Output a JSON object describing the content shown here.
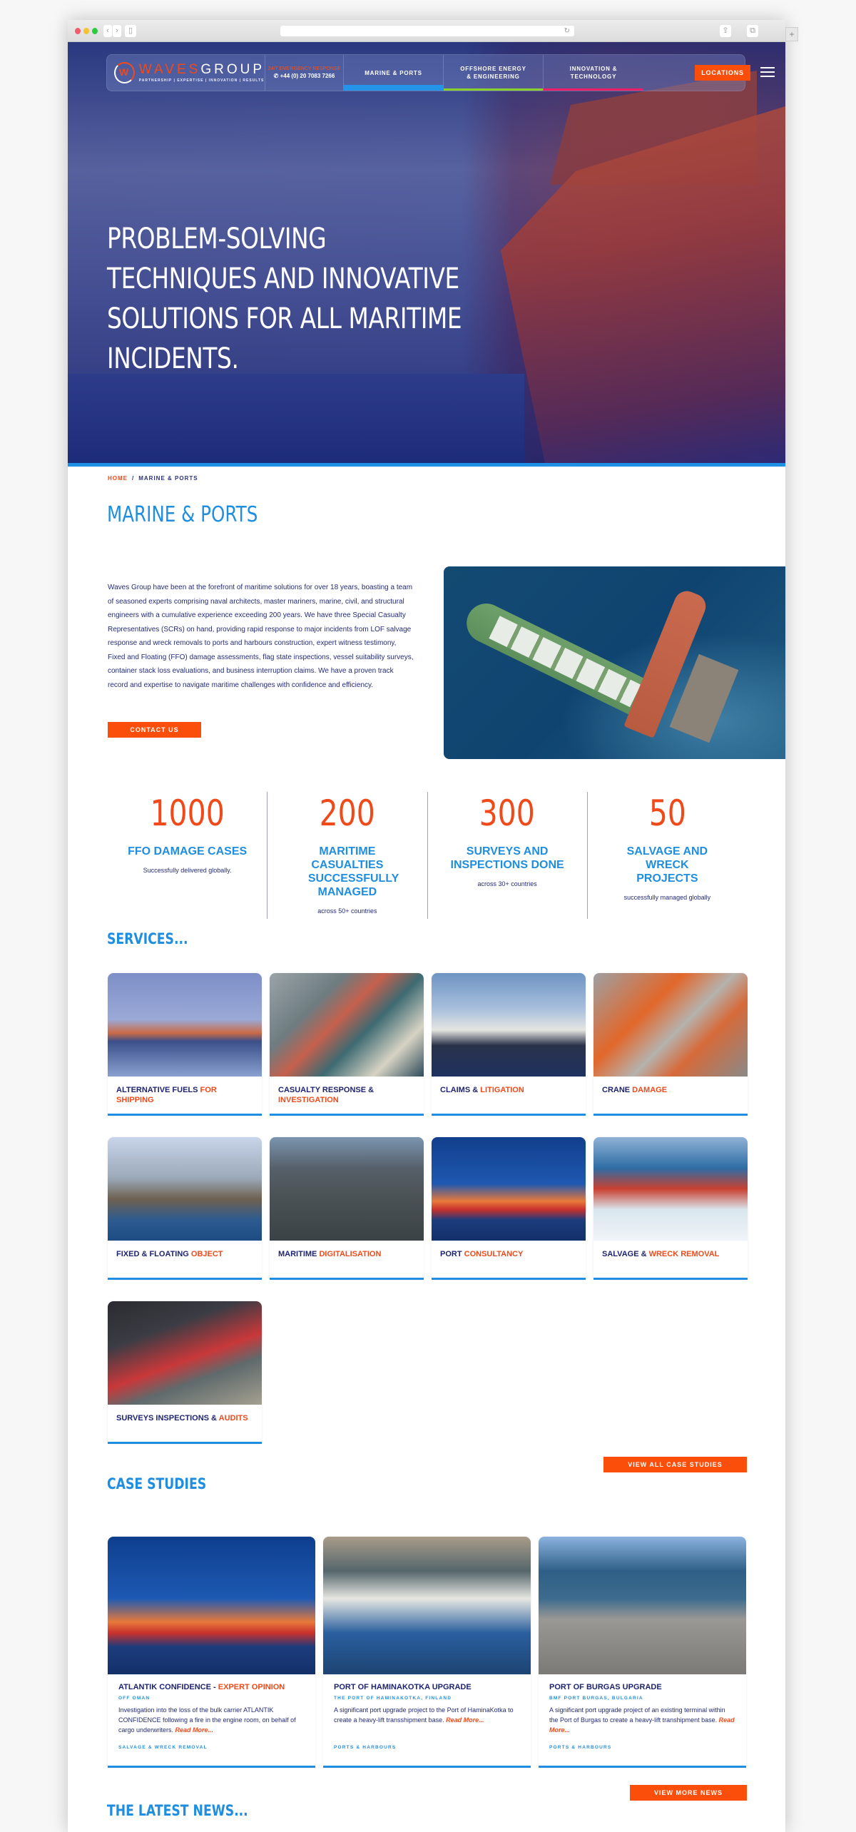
{
  "browser": {
    "back_icon": "‹",
    "forward_icon": "›",
    "sidebar_icon": "▯",
    "reload_icon": "↻",
    "share_icon": "⇪",
    "tabs_icon": "⧉",
    "new_tab_icon": "+"
  },
  "header": {
    "logo": {
      "waves": "WAVES",
      "group": "GROUP",
      "tagline": "PARTNERSHIP | EXPERTISE | INNOVATION | RESULTS"
    },
    "emergency": {
      "label": "24/7 EMERGENCY RESPONSE",
      "phone": "✆ +44 (0) 20 7083 7266"
    },
    "nav": [
      {
        "label": "MARINE & PORTS"
      },
      {
        "label": "OFFSHORE ENERGY & ENGINEERING"
      },
      {
        "label": "INNOVATION & TECHNOLOGY"
      }
    ],
    "locations_label": "LOCATIONS",
    "nav_colors": {
      "marine": "#2394e8",
      "offshore": "#8bd12e",
      "innovation": "#ec1e6a"
    }
  },
  "hero": {
    "headline": "PROBLEM-SOLVING\nTECHNIQUES AND INNOVATIVE\nSOLUTIONS FOR ALL MARITIME\nINCIDENTS."
  },
  "breadcrumb": {
    "home": "HOME",
    "separator": "/",
    "current": "MARINE & PORTS"
  },
  "intro": {
    "title": "MARINE & PORTS",
    "body": "Waves Group have been at the forefront of maritime solutions for over 18 years, boasting a team of seasoned experts comprising naval architects, master mariners, marine, civil, and structural engineers with a cumulative experience exceeding 200 years. We have three Special Casualty Representatives (SCRs) on hand,  providing rapid response to major incidents from LOF salvage response and wreck removals to ports and harbours construction, expert witness testimony, Fixed and Floating (FFO) damage assessments, flag state inspections, vessel suitability surveys, container stack loss evaluations, and business interruption claims. We have a proven track record and expertise to navigate maritime challenges with confidence and efficiency.",
    "cta": "CONTACT US"
  },
  "stats": [
    {
      "value": "1000",
      "label": "FFO DAMAGE CASES",
      "sub": "Successfully delivered globally."
    },
    {
      "value": "200",
      "label": "MARITIME CASUALTIES SUCCESSFULLY MANAGED",
      "sub": "across 50+ countries"
    },
    {
      "value": "300",
      "label": "SURVEYS AND INSPECTIONS DONE",
      "sub": "across 30+ countries"
    },
    {
      "value": "50",
      "label": "SALVAGE AND WRECK PROJECTS",
      "sub": "successfully managed globally"
    }
  ],
  "services": {
    "title": "SERVICES...",
    "items": [
      {
        "main": "ALTERNATIVE FUELS ",
        "highlight": "FOR SHIPPING"
      },
      {
        "main": "CASUALTY RESPONSE & ",
        "highlight": "INVESTIGATION"
      },
      {
        "main": "CLAIMS & ",
        "highlight": "LITIGATION"
      },
      {
        "main": "CRANE ",
        "highlight": "DAMAGE"
      },
      {
        "main": "FIXED & FLOATING ",
        "highlight": "OBJECT"
      },
      {
        "main": "MARITIME ",
        "highlight": "DIGITALISATION"
      },
      {
        "main": "PORT ",
        "highlight": "CONSULTANCY"
      },
      {
        "main": "SALVAGE & ",
        "highlight": "WRECK REMOVAL"
      },
      {
        "main": "SURVEYS INSPECTIONS & ",
        "highlight": "AUDITS"
      }
    ]
  },
  "case_studies": {
    "title": "CASE STUDIES",
    "view_all": "VIEW ALL CASE STUDIES",
    "items": [
      {
        "title": "ATLANTIK CONFIDENCE - ",
        "highlight": "EXPERT OPINION",
        "location": "OFF OMAN",
        "desc": "Investigation into the loss of the bulk carrier ATLANTIK CONFIDENCE following a fire in the engine room, on behalf of cargo underwriters. ",
        "read_more": "Read More...",
        "tag": "SALVAGE & WRECK REMOVAL"
      },
      {
        "title": "PORT OF HAMINAKOTKA UPGRADE",
        "highlight": "",
        "location": "THE PORT OF HAMINAKOTKA, FINLAND",
        "desc": "A significant port upgrade project to the Port of HaminaKotka to create a heavy-lift transshipment base. ",
        "read_more": "Read More...",
        "tag": "PORTS & HARBOURS"
      },
      {
        "title": "PORT OF BURGAS UPGRADE",
        "highlight": "",
        "location": "BMF PORT BURGAS, BULGARIA",
        "desc": "A significant port upgrade project of an existing terminal within the Port of Burgas to create a heavy-lift transhipment base. ",
        "read_more": "Read More...",
        "tag": "PORTS & HARBOURS"
      }
    ]
  },
  "news": {
    "title": "THE LATEST NEWS...",
    "view_more": "VIEW MORE NEWS"
  },
  "colors": {
    "brand_blue": "#1f8ee0",
    "brand_orange": "#fb4e0b",
    "navy": "#1e2470"
  }
}
